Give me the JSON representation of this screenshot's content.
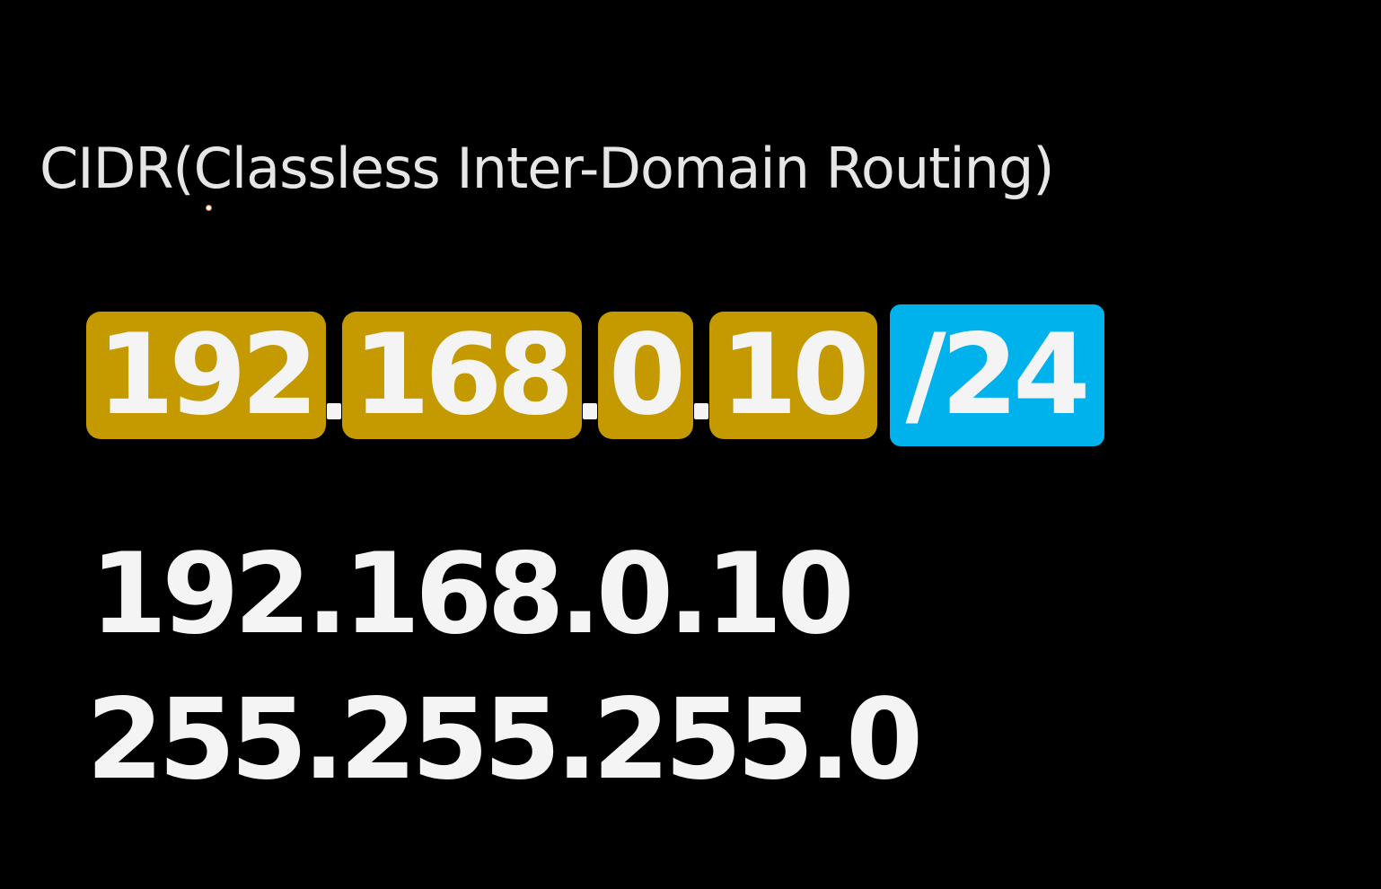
{
  "slide": {
    "title": "CIDR(Classless Inter-Domain Routing)",
    "cidr_notation": {
      "octets": [
        "192",
        "168",
        "0",
        "10"
      ],
      "prefix": "/24",
      "octet_color": "#c49a00",
      "prefix_color": "#00b2ec"
    },
    "ip_address": "192.168.0.10",
    "subnet_mask": "255.255.255.0"
  }
}
